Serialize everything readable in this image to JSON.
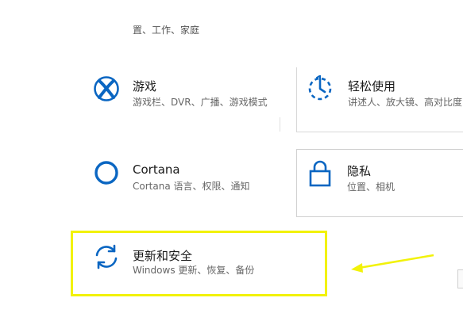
{
  "top": {
    "subtitle": "置、工作、家庭"
  },
  "tiles": [
    {
      "title": "游戏",
      "desc": "游戏栏、DVR、广播、游戏模式",
      "icon": "xbox-icon"
    },
    {
      "title": "轻松使用",
      "desc": "讲述人、放大镜、高对比度",
      "icon": "ease-of-access-icon"
    },
    {
      "title": "Cortana",
      "desc": "Cortana 语言、权限、通知",
      "icon": "cortana-icon"
    },
    {
      "title": "隐私",
      "desc": "位置、相机",
      "icon": "lock-icon"
    },
    {
      "title": "更新和安全",
      "desc": "Windows 更新、恢复、备份",
      "icon": "sync-icon"
    }
  ],
  "colors": {
    "accent": "#0a66c2",
    "highlight": "#f2f20a",
    "arrow": "#f2f20a"
  }
}
